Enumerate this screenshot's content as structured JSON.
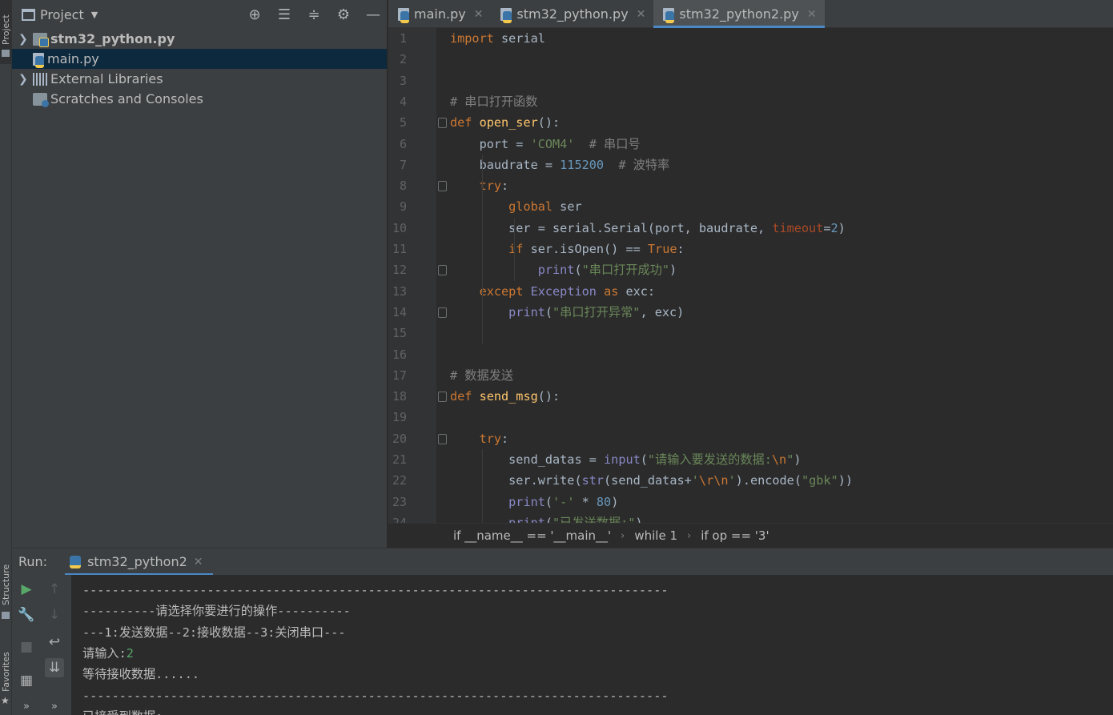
{
  "side_tabs": {
    "project": "Project",
    "structure": "Structure",
    "favorites": "Favorites"
  },
  "project_panel": {
    "title": "Project",
    "items": [
      {
        "label": "stm32_python.py",
        "expandable": true,
        "bold": true,
        "icon": "python-file-icon"
      },
      {
        "label": "main.py",
        "expandable": false,
        "selected": true,
        "icon": "python-file-icon"
      },
      {
        "label": "External Libraries",
        "expandable": true,
        "icon": "libraries-icon"
      },
      {
        "label": "Scratches and Consoles",
        "expandable": false,
        "icon": "scratches-icon"
      }
    ]
  },
  "editor_tabs": [
    {
      "label": "main.py",
      "active": false
    },
    {
      "label": "stm32_python.py",
      "active": false
    },
    {
      "label": "stm32_python2.py",
      "active": true
    }
  ],
  "code_lines": [
    {
      "n": "1",
      "t": "import serial"
    },
    {
      "n": "2",
      "t": ""
    },
    {
      "n": "3",
      "t": ""
    },
    {
      "n": "4",
      "t": "# 串口打开函数"
    },
    {
      "n": "5",
      "t": "def open_ser():"
    },
    {
      "n": "6",
      "t": "    port = 'COM4'  # 串口号"
    },
    {
      "n": "7",
      "t": "    baudrate = 115200  # 波特率"
    },
    {
      "n": "8",
      "t": "    try:"
    },
    {
      "n": "9",
      "t": "        global ser"
    },
    {
      "n": "10",
      "t": "        ser = serial.Serial(port, baudrate, timeout=2)"
    },
    {
      "n": "11",
      "t": "        if ser.isOpen() == True:"
    },
    {
      "n": "12",
      "t": "            print(\"串口打开成功\")"
    },
    {
      "n": "13",
      "t": "    except Exception as exc:"
    },
    {
      "n": "14",
      "t": "        print(\"串口打开异常\", exc)"
    },
    {
      "n": "15",
      "t": ""
    },
    {
      "n": "16",
      "t": ""
    },
    {
      "n": "17",
      "t": "# 数据发送"
    },
    {
      "n": "18",
      "t": "def send_msg():"
    },
    {
      "n": "19",
      "t": ""
    },
    {
      "n": "20",
      "t": "    try:"
    },
    {
      "n": "21",
      "t": "        send_datas = input(\"请输入要发送的数据:\\n\")"
    },
    {
      "n": "22",
      "t": "        ser.write(str(send_datas+'\\r\\n').encode(\"gbk\"))"
    },
    {
      "n": "23",
      "t": "        print('-' * 80)"
    },
    {
      "n": "24",
      "t": "        print(\"已发送数据:\")"
    }
  ],
  "breadcrumb": [
    "if __name__ == '__main__'",
    "while 1",
    "if op == '3'"
  ],
  "run_panel": {
    "label": "Run:",
    "tab": "stm32_python2"
  },
  "console_lines": [
    "--------------------------------------------------------------------------------",
    "----------请选择你要进行的操作----------",
    "---1:发送数据--2:接收数据--3:关闭串口---",
    "请输入:2",
    "等待接收数据......",
    "--------------------------------------------------------------------------------",
    "已接受到数据:"
  ],
  "colors": {
    "accent": "#4a88c7",
    "background": "#2b2b2b",
    "panel": "#3c3f41",
    "selection": "#0d293e"
  }
}
